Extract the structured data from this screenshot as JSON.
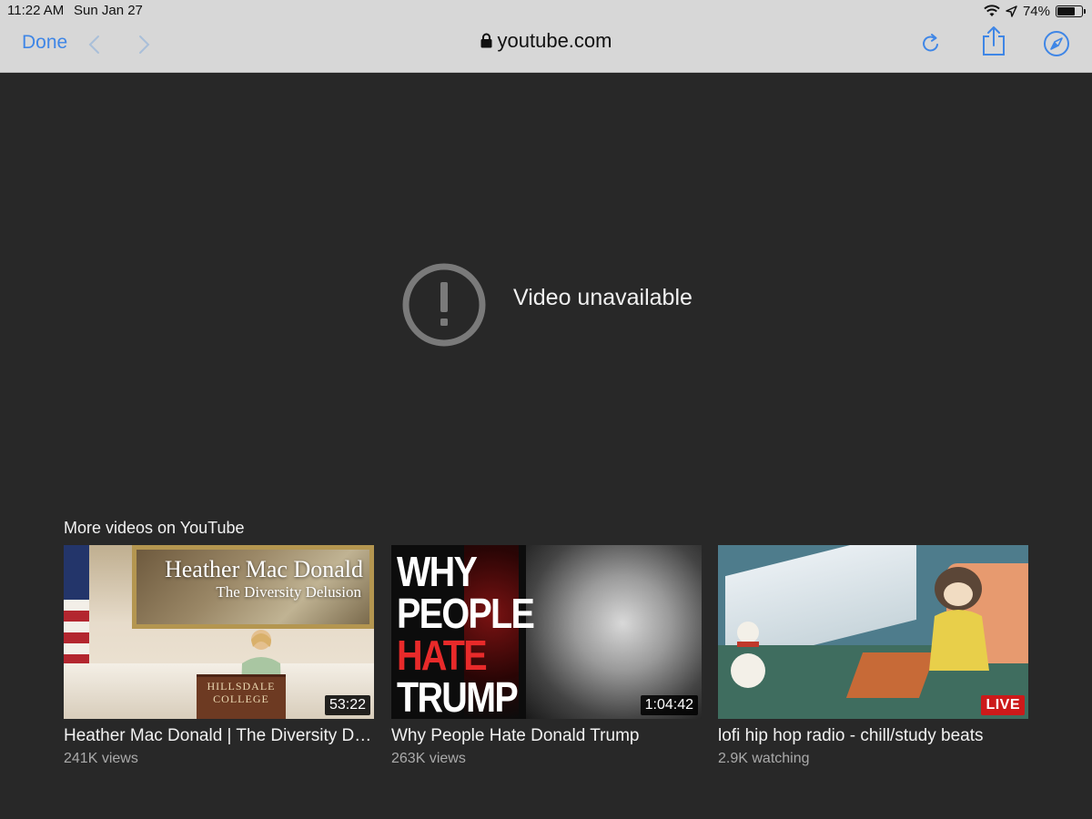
{
  "status_bar": {
    "time": "11:22 AM",
    "date": "Sun Jan 27",
    "battery_percent": "74%",
    "battery_level": 0.74
  },
  "browser": {
    "done_label": "Done",
    "url": "youtube.com",
    "back_icon": "chevron-left-icon",
    "forward_icon": "chevron-right-icon",
    "lock_icon": "lock-icon",
    "reload_icon": "reload-icon",
    "share_icon": "share-icon",
    "safari_icon": "compass-icon",
    "accent_color": "#3f86e6"
  },
  "player": {
    "error_icon": "exclamation-circle-icon",
    "message": "Video unavailable"
  },
  "more_videos": {
    "title": "More videos on YouTube",
    "videos": [
      {
        "title": "Heather Mac Donald | The Diversity Delusion",
        "meta": "241K views",
        "badge": "53:22",
        "thumb_title": "Heather Mac Donald",
        "thumb_subtitle": "The Diversity Delusion",
        "podium_line1": "HILLSDALE",
        "podium_line2": "COLLEGE"
      },
      {
        "title": "Why People Hate Donald Trump",
        "meta": "263K views",
        "badge": "1:04:42",
        "thumb_words": [
          "WHY",
          "PEOPLE",
          "HATE",
          "TRUMP"
        ]
      },
      {
        "title": "lofi hip hop radio - chill/study beats",
        "meta": "2.9K watching",
        "badge": "LIVE",
        "badge_color": "#cc1a1a"
      }
    ]
  }
}
